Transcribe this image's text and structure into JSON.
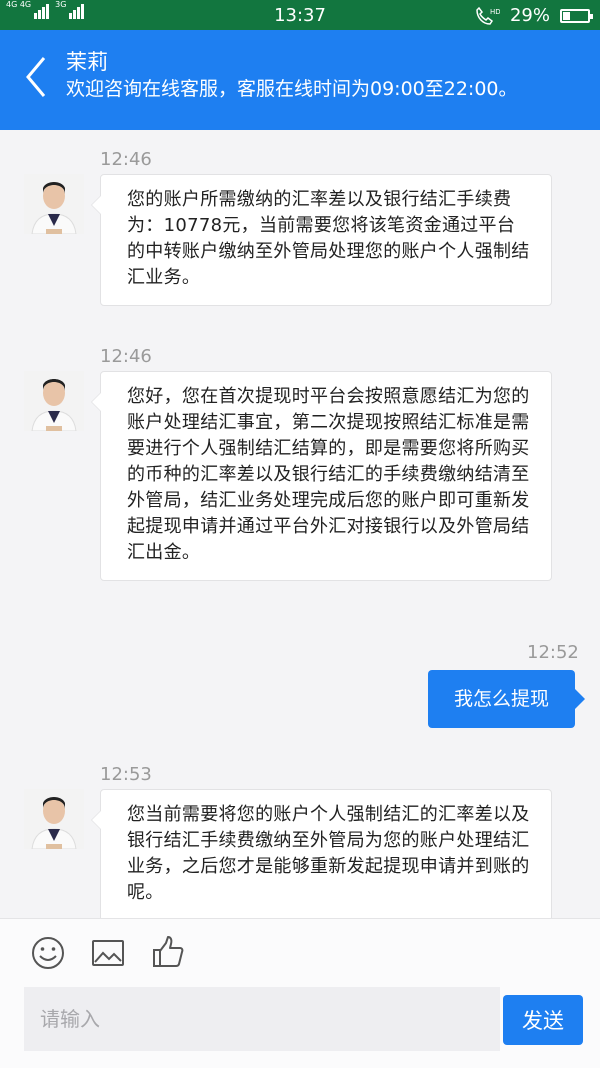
{
  "status_bar": {
    "signal1_label": "4G 4G",
    "signal2_label": "3G",
    "time": "13:37",
    "battery": "29%",
    "battery_level": 0.29
  },
  "header": {
    "name": "茉莉",
    "subtitle": "欢迎咨询在线客服，客服在线时间为09:00至22:00。"
  },
  "messages": [
    {
      "time": "12:46",
      "from": "agent",
      "text": "您的账户所需缴纳的汇率差以及银行结汇手续费为：10778元，当前需要您将该笔资金通过平台的中转账户缴纳至外管局处理您的账户个人强制结汇业务。"
    },
    {
      "time": "12:46",
      "from": "agent",
      "text": "您好，您在首次提现时平台会按照意愿结汇为您的账户处理结汇事宜，第二次提现按照结汇标准是需要进行个人强制结汇结算的，即是需要您将所购买的币种的汇率差以及银行结汇的手续费缴纳结清至外管局，结汇业务处理完成后您的账户即可重新发起提现申请并通过平台外汇对接银行以及外管局结汇出金。"
    },
    {
      "time": "12:52",
      "from": "user",
      "text": "我怎么提现"
    },
    {
      "time": "12:53",
      "from": "agent",
      "text": "您当前需要将您的账户个人强制结汇的汇率差以及银行结汇手续费缴纳至外管局为您的账户处理结汇业务，之后您才是能够重新发起提现申请并到账的呢。"
    }
  ],
  "composer": {
    "icons": [
      "emoji-icon",
      "image-icon",
      "thumbs-up-icon"
    ],
    "placeholder": "请输入",
    "send_label": "发送"
  },
  "colors": {
    "accent": "#1e7ff1",
    "status_bar": "#12763f",
    "background": "#f4f4f6"
  }
}
